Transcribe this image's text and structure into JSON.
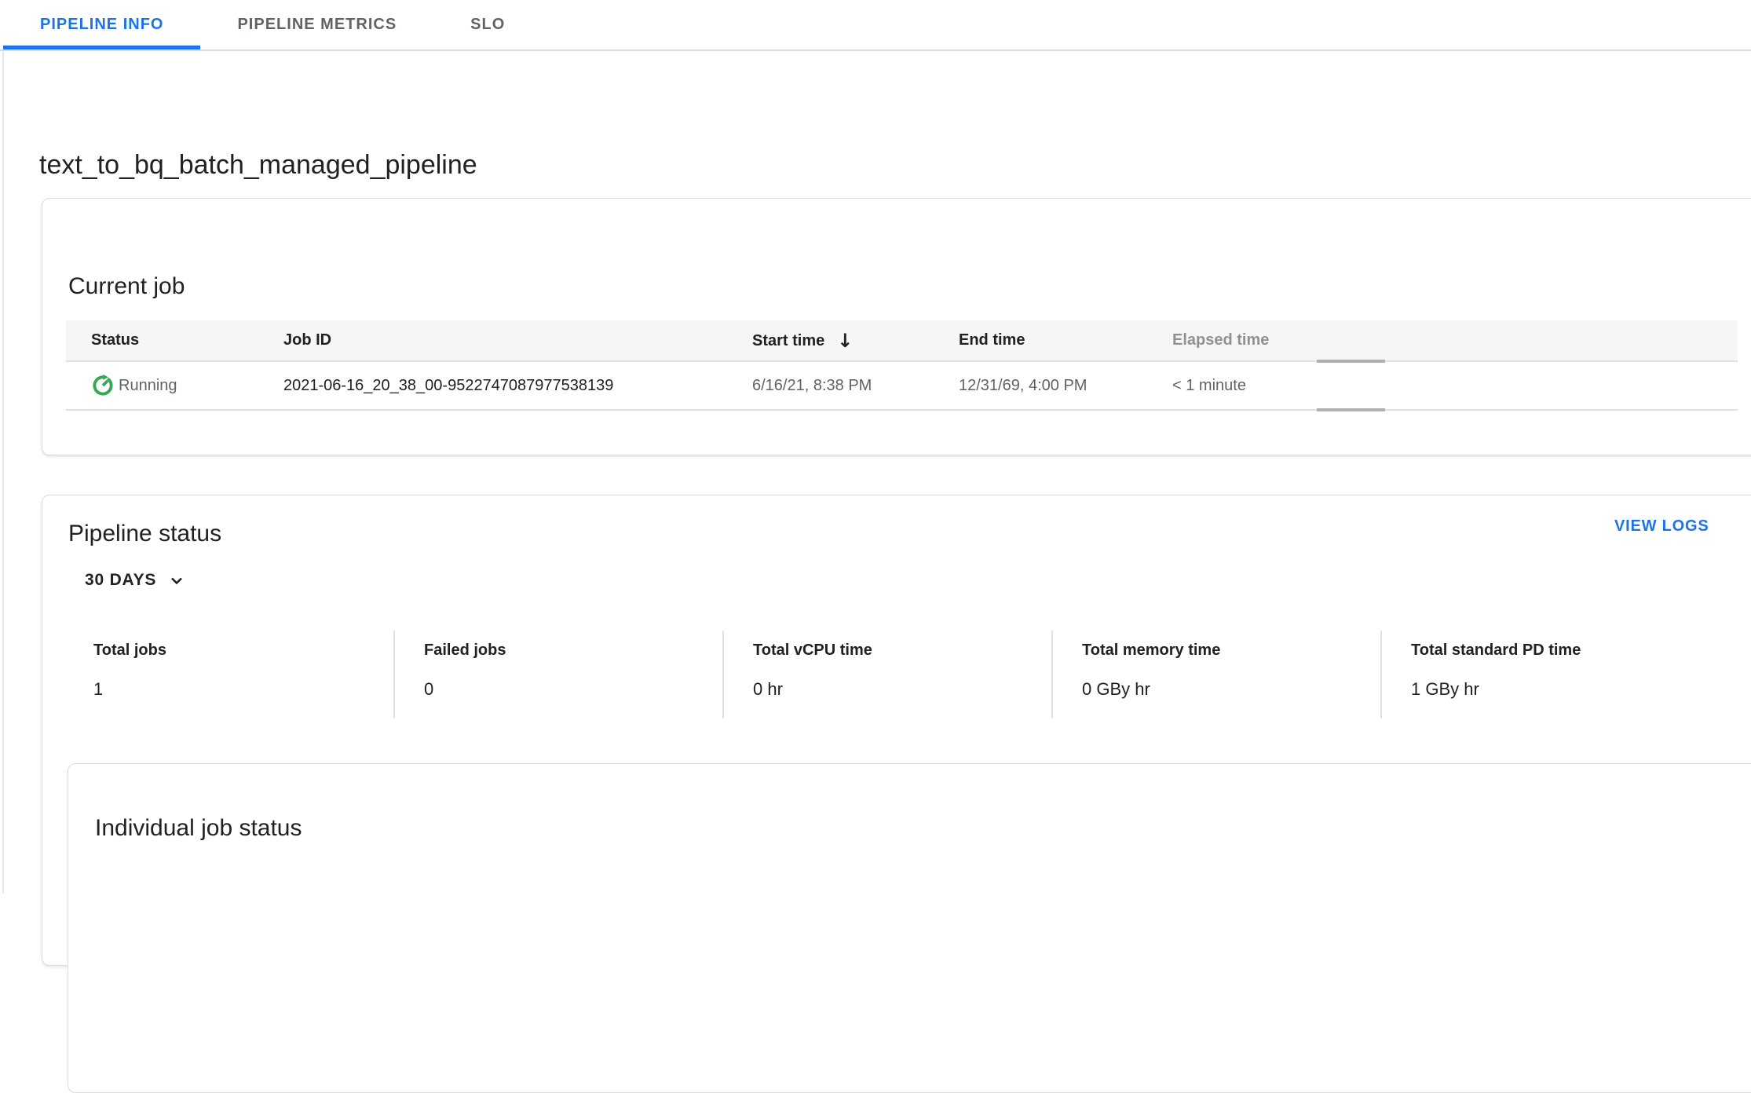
{
  "tabs": [
    {
      "label": "PIPELINE INFO",
      "active": true
    },
    {
      "label": "PIPELINE METRICS",
      "active": false
    },
    {
      "label": "SLO",
      "active": false
    }
  ],
  "page_title": "text_to_bq_batch_managed_pipeline",
  "current_job": {
    "title": "Current job",
    "columns": {
      "status": "Status",
      "job_id": "Job ID",
      "start_time": "Start time",
      "end_time": "End time",
      "elapsed_time": "Elapsed time"
    },
    "sort_arrow": "↓",
    "row": {
      "status": "Running",
      "job_id": "2021-06-16_20_38_00-9522747087977538139",
      "start_time": "6/16/21, 8:38 PM",
      "end_time": "12/31/69, 4:00 PM",
      "elapsed_time": "< 1 minute"
    }
  },
  "pipeline_status": {
    "title": "Pipeline status",
    "view_logs_label": "VIEW LOGS",
    "time_range": "30 DAYS",
    "stats": [
      {
        "label": "Total jobs",
        "value": "1"
      },
      {
        "label": "Failed jobs",
        "value": "0"
      },
      {
        "label": "Total vCPU time",
        "value": "0 hr"
      },
      {
        "label": "Total memory time",
        "value": "0 GBy hr"
      },
      {
        "label": "Total standard PD time",
        "value": "1 GBy hr"
      }
    ],
    "individual_job_status_title": "Individual job status"
  },
  "colors": {
    "accent_blue": "#1a73e8",
    "running_green": "#34a853",
    "text_dark": "#202124",
    "text_gray": "#5f6368"
  }
}
